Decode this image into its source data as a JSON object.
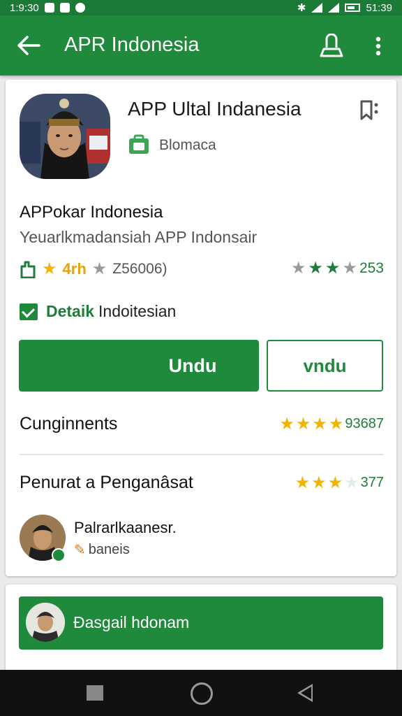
{
  "status_bar": {
    "time": "1:9:30",
    "battery_time": "51:39"
  },
  "app_bar": {
    "title": "APR Indonesia"
  },
  "app": {
    "title": "APP Ultal Indanesia",
    "developer": "Blomaca",
    "name": "APPokar Indonesia",
    "subtitle": "Yeuarlkmadansiah APP Indonsair",
    "rating": "4rh",
    "reviews": "Z56006)",
    "right_count": "253",
    "check_label_green": "Detaik",
    "check_label_dark": "Indoitesian"
  },
  "buttons": {
    "primary": "Undu",
    "secondary": "vndu"
  },
  "rows": [
    {
      "label": "Cunginnents",
      "count": "93687"
    },
    {
      "label": "Penurat a Penganâsat",
      "count": "377"
    }
  ],
  "reviewer": {
    "name": "Palrarlkaanesr.",
    "sub": "baneis"
  },
  "banner": {
    "text": "Đasgail hdonam"
  },
  "colors": {
    "primary": "#1f8a3c",
    "status_bar": "#1b7a35",
    "star_gold": "#f2b400"
  },
  "icons": [
    "back-arrow-icon",
    "account-icon",
    "more-vert-icon",
    "bookmark-icon",
    "developer-icon",
    "badge-icon",
    "star-icon",
    "check-icon",
    "pencil-icon",
    "nav-recent-icon",
    "nav-home-icon",
    "nav-back-icon"
  ]
}
